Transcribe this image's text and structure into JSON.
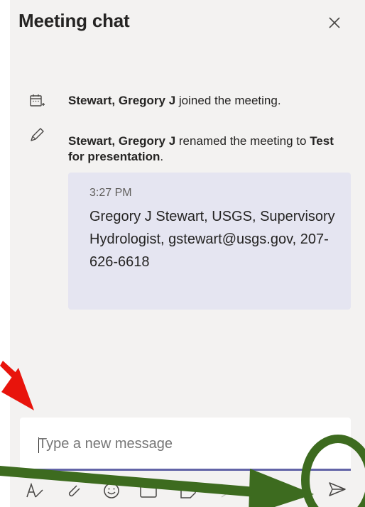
{
  "header": {
    "title": "Meeting chat"
  },
  "events": [
    {
      "icon": "calendar-join-icon",
      "name": "Stewart, Gregory J",
      "action": " joined the meeting."
    },
    {
      "icon": "pencil-icon",
      "name": "Stewart, Gregory J",
      "action": " renamed the meeting to ",
      "new_title": "Test for presentation",
      "suffix": "."
    }
  ],
  "message": {
    "time": "3:27 PM",
    "text": "Gregory J Stewart, USGS, Supervisory Hydrologist, gstewart@usgs.gov, 207-626-6618"
  },
  "compose": {
    "placeholder": "Type a new message"
  },
  "toolbar": {
    "icons": [
      "format-icon",
      "attach-icon",
      "emoji-icon",
      "gif-icon",
      "sticker-icon",
      "more-icon",
      "send-icon"
    ]
  },
  "annotations": {
    "arrow_color": "#e8140c",
    "green_color": "#3d6b1f"
  },
  "colors": {
    "panel_bg": "#f3f2f1",
    "bubble_bg": "#e5e5f1",
    "accent": "#6264a7"
  }
}
